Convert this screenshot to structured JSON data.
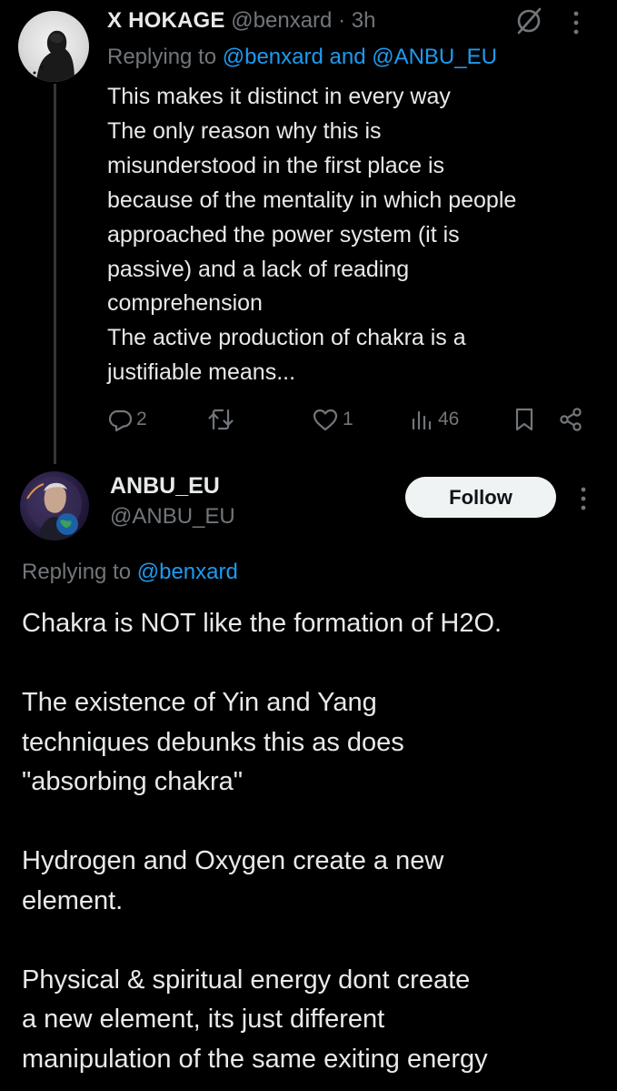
{
  "reply_tweet": {
    "author_name": "X HOKAGE",
    "author_handle": "@benxard",
    "separator": "·",
    "time": "3h",
    "replying_prefix": "Replying to ",
    "replying_to": "@benxard and @ANBU_EU",
    "body_lines": [
      "This makes it distinct in every way",
      "The only reason why this is",
      "misunderstood in the first place is",
      "because of the mentality in which people",
      "approached the power system (it is",
      "passive) and a lack of reading",
      "comprehension",
      "The active production of chakra is a",
      "justifiable means..."
    ],
    "actions": {
      "replies": "2",
      "retweets": "",
      "likes": "1",
      "views": "46"
    },
    "icons": [
      "grok-icon",
      "more-icon",
      "reply-icon",
      "retweet-icon",
      "like-icon",
      "views-icon",
      "bookmark-icon",
      "share-icon"
    ]
  },
  "main_tweet": {
    "author_name": "ANBU_EU",
    "author_handle": "@ANBU_EU",
    "follow_label": "Follow",
    "replying_prefix": "Replying to ",
    "replying_to": "@benxard",
    "paragraphs": [
      [
        "Chakra is NOT like the formation of H2O."
      ],
      [
        "The existence of Yin and Yang",
        "techniques debunks this as does",
        "\"absorbing chakra\""
      ],
      [
        "Hydrogen and Oxygen create a new",
        "element."
      ],
      [
        "Physical & spiritual energy dont create",
        "a new element, its just different",
        "manipulation of the same exiting energy"
      ]
    ]
  },
  "colors": {
    "background": "#000000",
    "text_primary": "#e7e9ea",
    "text_secondary": "#71767b",
    "link": "#1d9bf0",
    "follow_bg": "#eff3f4"
  }
}
